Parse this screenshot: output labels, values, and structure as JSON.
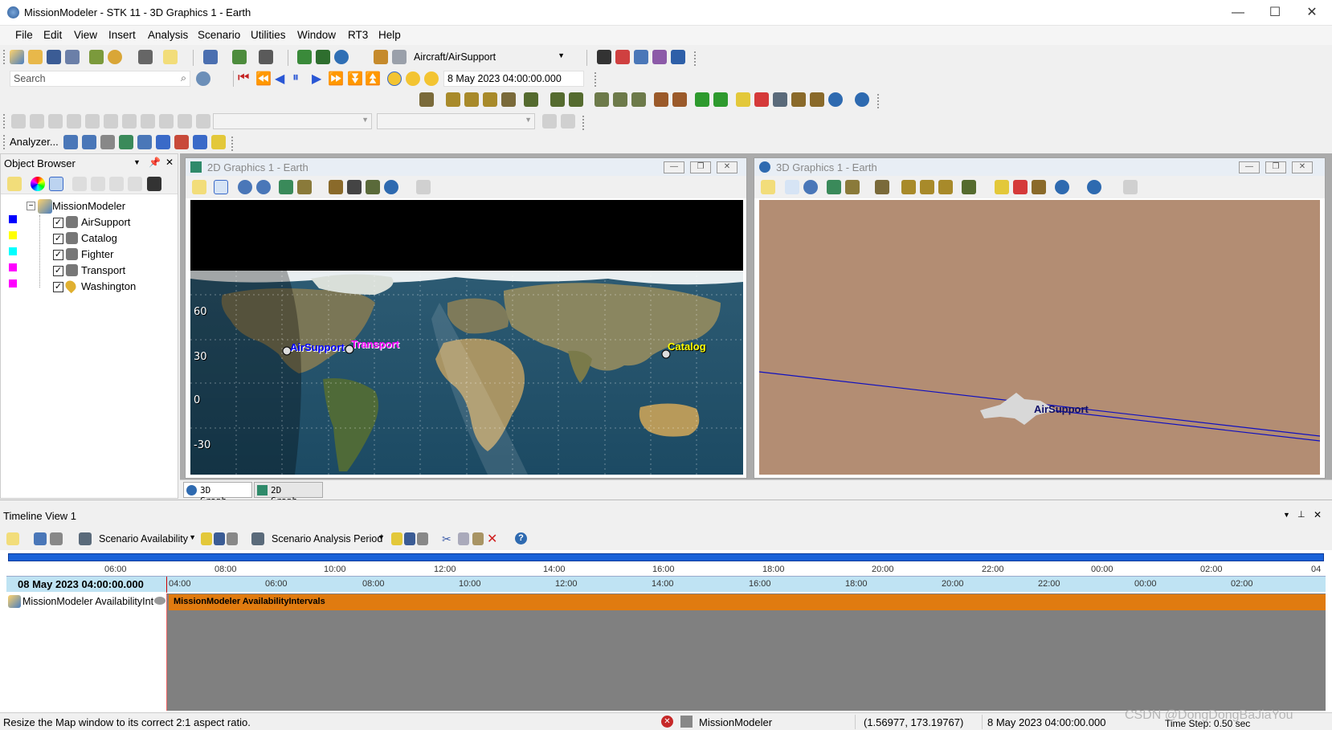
{
  "window": {
    "title": "MissionModeler - STK 11 - 3D Graphics 1 - Earth"
  },
  "menu": [
    "File",
    "Edit",
    "View",
    "Insert",
    "Analysis",
    "Scenario",
    "Utilities",
    "Window",
    "RT3",
    "Help"
  ],
  "toolbar": {
    "object_combo": "Aircraft/AirSupport",
    "search_placeholder": "Search",
    "time_field": "8 May 2023 04:00:00.000",
    "analyzer_label": "Analyzer..."
  },
  "object_browser": {
    "title": "Object Browser",
    "root": "MissionModeler",
    "items": [
      {
        "label": "AirSupport",
        "color": "#0000ff",
        "checked": true
      },
      {
        "label": "Catalog",
        "color": "#ffff00",
        "checked": true
      },
      {
        "label": "Fighter",
        "color": "#00ffff",
        "checked": true
      },
      {
        "label": "Transport",
        "color": "#ff00ff",
        "checked": true
      },
      {
        "label": "Washington",
        "color": "#ff00ff",
        "checked": true
      }
    ]
  },
  "graphics2d": {
    "title": "2D Graphics 1 - Earth",
    "lat_labels": [
      "60",
      "30",
      "0",
      "-30"
    ],
    "labels": {
      "airsupport": "AirSupport",
      "transport": "Transport",
      "catalog": "Catalog"
    }
  },
  "graphics3d": {
    "title": "3D Graphics 1 - Earth",
    "label": "AirSupport"
  },
  "tabs": [
    "3D Graph...",
    "2D Graph..."
  ],
  "timeline": {
    "title": "Timeline View 1",
    "combo1": "Scenario Availability",
    "combo2": "Scenario Analysis Period",
    "top_ticks": [
      "06:00",
      "08:00",
      "10:00",
      "12:00",
      "14:00",
      "16:00",
      "18:00",
      "20:00",
      "22:00",
      "00:00",
      "02:00",
      "04"
    ],
    "current_time": "08 May 2023 04:00:00.000",
    "bottom_ticks": [
      "04:00",
      "06:00",
      "08:00",
      "10:00",
      "12:00",
      "14:00",
      "16:00",
      "18:00",
      "20:00",
      "22:00",
      "00:00",
      "02:00"
    ],
    "row_label": "MissionModeler AvailabilityInt",
    "bar_label": "MissionModeler AvailabilityIntervals"
  },
  "status": {
    "message": "Resize the Map window to its correct 2:1 aspect ratio.",
    "object": "MissionModeler",
    "coords": "(1.56977, 173.19767)",
    "time": "8 May 2023 04:00:00.000",
    "watermark": "CSDN @DongDongBaJiaYou",
    "timestep": "Time Step: 0.50 sec"
  }
}
